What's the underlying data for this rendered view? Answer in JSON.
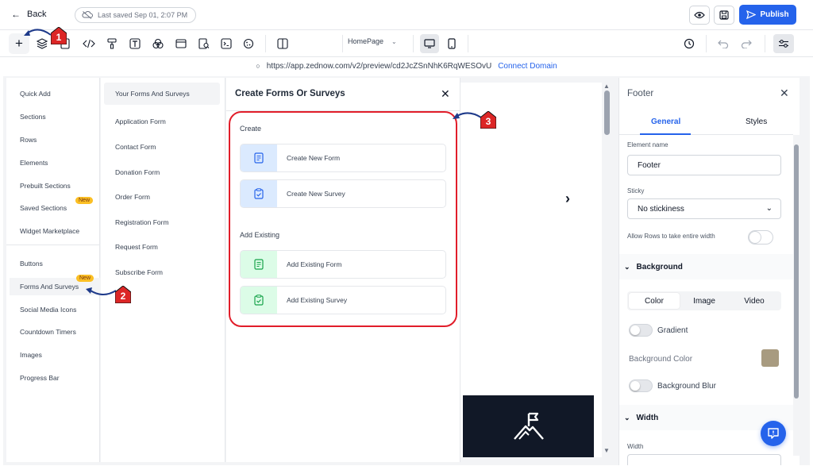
{
  "header": {
    "back_label": "Back",
    "last_saved": "Last saved Sep 01, 2:07 PM",
    "publish_label": "Publish"
  },
  "toolbar": {
    "page_name": "HomePage"
  },
  "url_bar": {
    "url": "https://app.zednow.com/v2/preview/cd2JcZSnNhK6RqWESOvU",
    "connect_label": "Connect Domain"
  },
  "add_menu": {
    "items": [
      {
        "label": "Quick Add"
      },
      {
        "label": "Sections"
      },
      {
        "label": "Rows"
      },
      {
        "label": "Elements"
      },
      {
        "label": "Prebuilt Sections"
      },
      {
        "label": "Saved Sections",
        "badge": "New"
      },
      {
        "label": "Widget Marketplace"
      },
      {
        "label": "Buttons"
      },
      {
        "label": "Forms And Surveys",
        "badge": "New"
      },
      {
        "label": "Social Media Icons"
      },
      {
        "label": "Countdown Timers"
      },
      {
        "label": "Images"
      },
      {
        "label": "Progress Bar"
      }
    ]
  },
  "forms_menu": {
    "items": [
      {
        "label": "Your Forms And Surveys"
      },
      {
        "label": "Application Form"
      },
      {
        "label": "Contact Form"
      },
      {
        "label": "Donation Form"
      },
      {
        "label": "Order Form"
      },
      {
        "label": "Registration Form"
      },
      {
        "label": "Request Form"
      },
      {
        "label": "Subscribe Form"
      }
    ]
  },
  "create_panel": {
    "title": "Create Forms Or Surveys",
    "create_heading": "Create",
    "add_existing_heading": "Add Existing",
    "create_new_form": "Create New Form",
    "create_new_survey": "Create New Survey",
    "add_existing_form": "Add Existing Form",
    "add_existing_survey": "Add Existing Survey"
  },
  "properties": {
    "title": "Footer",
    "tab_general": "General",
    "tab_styles": "Styles",
    "element_name_label": "Element name",
    "element_name_value": "Footer",
    "sticky_label": "Sticky",
    "sticky_value": "No stickiness",
    "allow_rows_label": "Allow Rows to take entire width",
    "background_heading": "Background",
    "bg_tabs": [
      "Color",
      "Image",
      "Video"
    ],
    "gradient_label": "Gradient",
    "bg_color_label": "Background Color",
    "bg_color_value": "#a89b80",
    "bg_blur_label": "Background Blur",
    "width_heading": "Width",
    "width_label": "Width"
  },
  "steps": [
    "1",
    "2",
    "3"
  ],
  "colors": {
    "accent": "#2563eb",
    "highlight": "#e11d2a",
    "badge": "#fbbf24"
  }
}
